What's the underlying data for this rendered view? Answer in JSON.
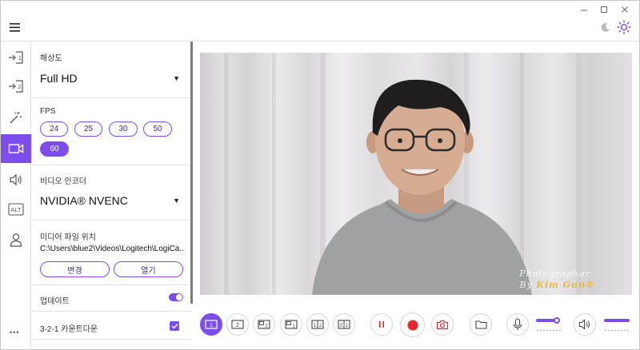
{
  "window": {
    "minimize_glyph": "—",
    "maximize_glyph": "□",
    "close_glyph": "✕"
  },
  "header": {
    "menu_icon": "hamburger-icon",
    "theme_dark_icon": "moon-icon",
    "theme_light_icon": "sun-icon"
  },
  "rail": {
    "items": [
      {
        "icon": "input-1-icon"
      },
      {
        "icon": "input-2-icon"
      },
      {
        "icon": "magic-wand-icon"
      },
      {
        "icon": "video-camera-icon",
        "active": true
      },
      {
        "icon": "speaker-icon"
      },
      {
        "icon": "alt-key-icon",
        "text": "ALT"
      },
      {
        "icon": "person-icon"
      }
    ],
    "more_glyph": "•••"
  },
  "settings": {
    "resolution_label": "해상도",
    "resolution_value": "Full HD",
    "fps_label": "FPS",
    "fps_options": [
      "24",
      "25",
      "30",
      "50",
      "60"
    ],
    "fps_selected": "60",
    "encoder_label": "비디오 인코더",
    "encoder_value": "NVIDIA® NVENC",
    "media_label": "미디어 파일 위치",
    "media_path": "C:\\Users\\blue2\\Videos\\Logitech\\LogiCa...",
    "change_button": "변경",
    "open_button": "열기",
    "update_label": "업데이트",
    "update_enabled": true,
    "countdown_label": "3-2-1 카운트다운",
    "countdown_checked": true
  },
  "preview": {
    "watermark_line1": "Photographer",
    "watermark_line2_prefix": "By",
    "watermark_line2_name": "Kim Gun®"
  },
  "toolbar": {
    "layouts": [
      "1",
      "2",
      "1+2",
      "1+1",
      "1|2",
      "2|1"
    ],
    "layout_selected": "1",
    "pause_icon": "pause-icon",
    "record_icon": "record-icon",
    "snapshot_icon": "camera-icon",
    "folder_icon": "folder-icon",
    "mic_icon": "microphone-icon",
    "speaker_icon": "speaker-icon",
    "mic_level": 0.7,
    "speaker_level": 0.85
  },
  "colors": {
    "accent": "#7c4dea",
    "record_red": "#e8262d"
  }
}
